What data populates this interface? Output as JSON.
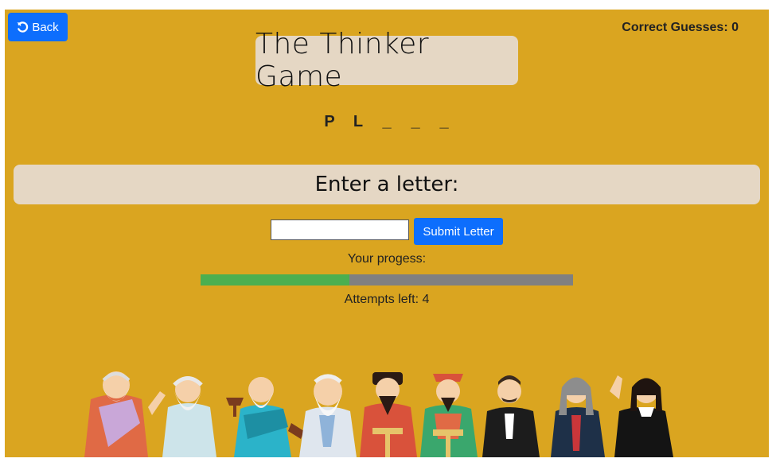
{
  "header": {
    "back_label": "Back",
    "score_text": "Correct Guesses: 0"
  },
  "game": {
    "title": "The Thinker Game",
    "word_slots": [
      "P",
      "L",
      "_",
      "_",
      "_"
    ],
    "prompt": "Enter a letter:",
    "input_value": "",
    "submit_label": "Submit Letter",
    "progress_label": "Your progess:",
    "progress_fraction": 0.4,
    "attempts_text": "Attempts left: 4"
  },
  "colors": {
    "background": "#DAA520",
    "panel": "#E5D7C4",
    "button": "#0d6efd",
    "progress_fill": "#4CAF50",
    "progress_track": "#808080"
  },
  "icons": {
    "back": "undo-arrow-icon"
  },
  "illustration": {
    "name": "philosophers-group-illustration",
    "figures": [
      "socrates",
      "plato",
      "aristotle",
      "laozi",
      "confucius-1",
      "confucius-2",
      "nietzsche",
      "newton",
      "descartes"
    ]
  }
}
